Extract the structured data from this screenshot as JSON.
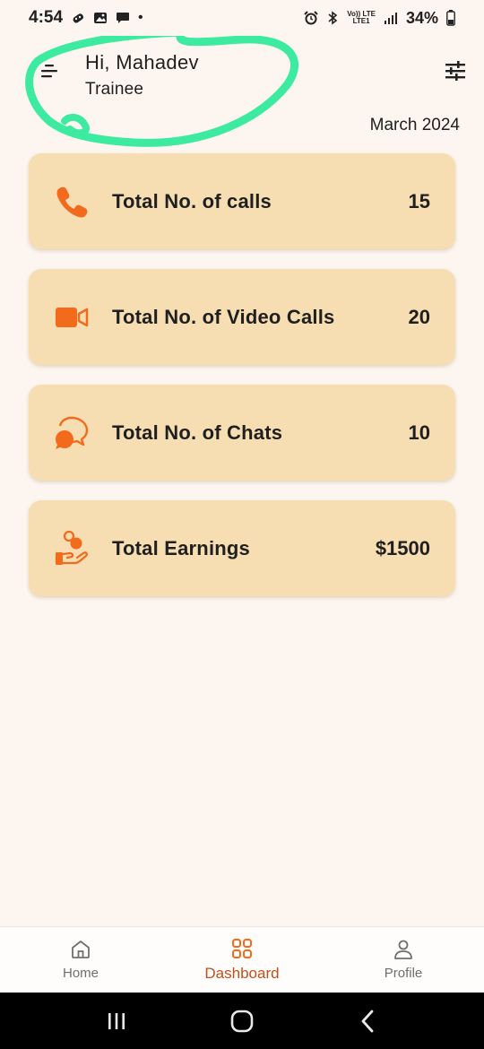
{
  "status_bar": {
    "time": "4:54",
    "dot": "•",
    "network_top": "Vo)) LTE",
    "network_bottom": "LTE1",
    "battery": "34%",
    "icons": [
      "game-icon",
      "image-icon",
      "chat-icon",
      "alarm-icon",
      "bluetooth-icon",
      "signal-icon",
      "battery-icon"
    ]
  },
  "header": {
    "greeting": "Hi, Mahadev",
    "role": "Trainee",
    "month": "March 2024",
    "highlight_color": "#3deba0"
  },
  "cards": [
    {
      "label": "Total No. of calls",
      "value": "15",
      "icon": "phone-icon"
    },
    {
      "label": "Total No. of Video Calls",
      "value": "20",
      "icon": "video-camera-icon"
    },
    {
      "label": "Total No. of Chats",
      "value": "10",
      "icon": "chat-bubbles-icon"
    },
    {
      "label": "Total Earnings",
      "value": "$1500",
      "icon": "earnings-hand-icon"
    }
  ],
  "bottom_nav": {
    "items": [
      {
        "label": "Home",
        "icon": "home-icon"
      },
      {
        "label": "Dashboard",
        "icon": "dashboard-grid-icon",
        "active": true
      },
      {
        "label": "Profile",
        "icon": "profile-icon"
      }
    ]
  },
  "colors": {
    "accent": "#f26a1b",
    "card_bg": "#f6deb2",
    "page_bg": "#fdf6f0",
    "active_nav": "#c0501a"
  }
}
